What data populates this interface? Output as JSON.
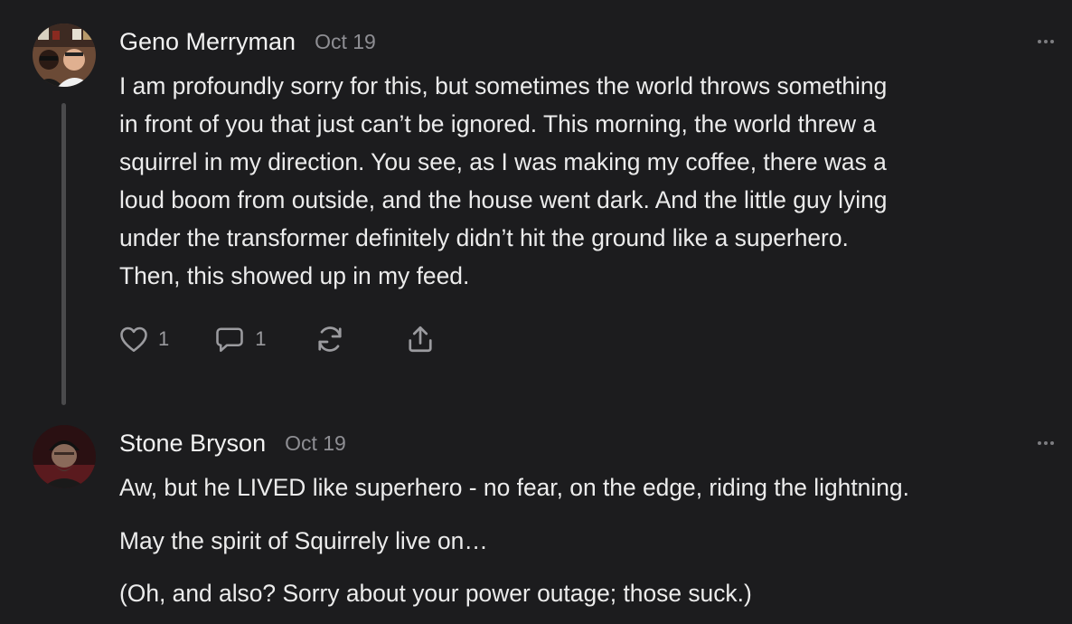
{
  "comments": [
    {
      "author": "Geno Merryman",
      "date": "Oct 19",
      "avatar_icon": "user-photo-avatar",
      "lines": [
        "I am profoundly sorry for this, but sometimes the world throws something",
        "in front of you that just can’t be ignored. This morning, the world threw a",
        "squirrel in my direction. You see, as I was making my coffee, there was a",
        "loud boom from outside, and the house went dark. And the little guy lying",
        "under the transformer definitely didn’t hit the ground like a superhero.",
        "Then, this showed up in my feed."
      ],
      "actions": {
        "like_count": "1",
        "reply_count": "1",
        "icons": [
          "heart-icon",
          "comment-bubble-icon",
          "restack-icon",
          "share-icon"
        ]
      }
    },
    {
      "author": "Stone Bryson",
      "date": "Oct 19",
      "avatar_icon": "user-photo-avatar",
      "paragraphs": [
        "Aw, but he LIVED like superhero - no fear, on the edge, riding the lightning.",
        "May the spirit of Squirrely live on…",
        "(Oh, and also? Sorry about your power outage; those suck.)"
      ]
    }
  ],
  "colors": {
    "background": "#1c1c1e",
    "text": "#ececec",
    "muted": "#8e8e93",
    "thread_line": "#4a4a4c"
  }
}
